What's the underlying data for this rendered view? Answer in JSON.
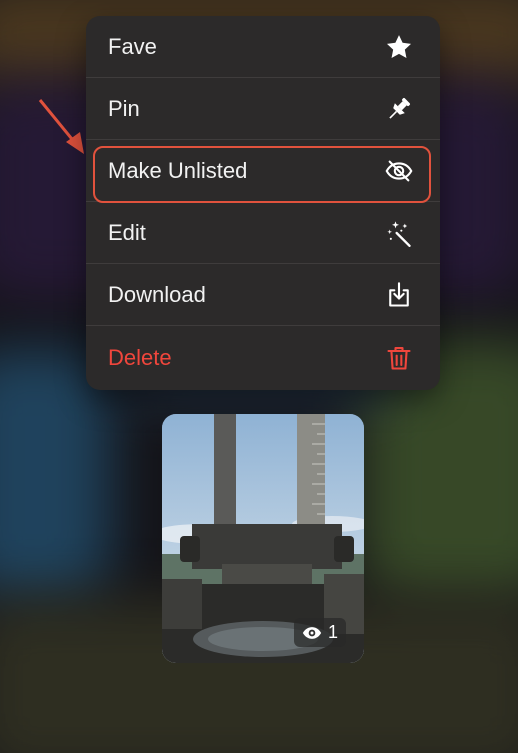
{
  "menu": {
    "items": [
      {
        "label": "Fave",
        "icon": "star-icon"
      },
      {
        "label": "Pin",
        "icon": "pin-icon"
      },
      {
        "label": "Make Unlisted",
        "icon": "eye-slash-icon"
      },
      {
        "label": "Edit",
        "icon": "magic-wand-icon"
      },
      {
        "label": "Download",
        "icon": "download-icon"
      },
      {
        "label": "Delete",
        "icon": "trash-icon"
      }
    ],
    "highlighted_item": "Make Unlisted"
  },
  "preview": {
    "view_count": "1",
    "view_icon": "eye-icon"
  },
  "colors": {
    "menu_background": "#2c2a2a",
    "text": "#f2f2f2",
    "danger": "#f0463c",
    "annotation": "#e1523d"
  }
}
